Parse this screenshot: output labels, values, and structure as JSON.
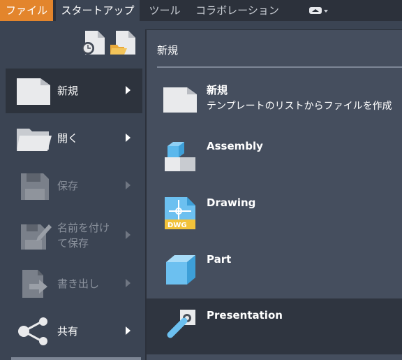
{
  "menubar": {
    "tabs": [
      "ファイル",
      "スタートアップ",
      "ツール",
      "コラボレーション"
    ]
  },
  "left_menu": {
    "items": [
      {
        "label": "新規",
        "enabled": true
      },
      {
        "label": "開く",
        "enabled": true
      },
      {
        "label": "保存",
        "enabled": false
      },
      {
        "label": "名前を付け\nて保存",
        "enabled": false
      },
      {
        "label": "書き出し",
        "enabled": false
      },
      {
        "label": "共有",
        "enabled": true
      }
    ]
  },
  "submenu": {
    "title": "新規",
    "items": [
      {
        "name": "新規",
        "description": "テンプレートのリストからファイルを作成"
      },
      {
        "name": "Assembly"
      },
      {
        "name": "Drawing"
      },
      {
        "name": "Part"
      },
      {
        "name": "Presentation"
      }
    ]
  },
  "colors": {
    "file_tab": "#e3852c",
    "panel": "#3b4453",
    "submenu": "#454e5e",
    "menubar": "#2c313b"
  }
}
